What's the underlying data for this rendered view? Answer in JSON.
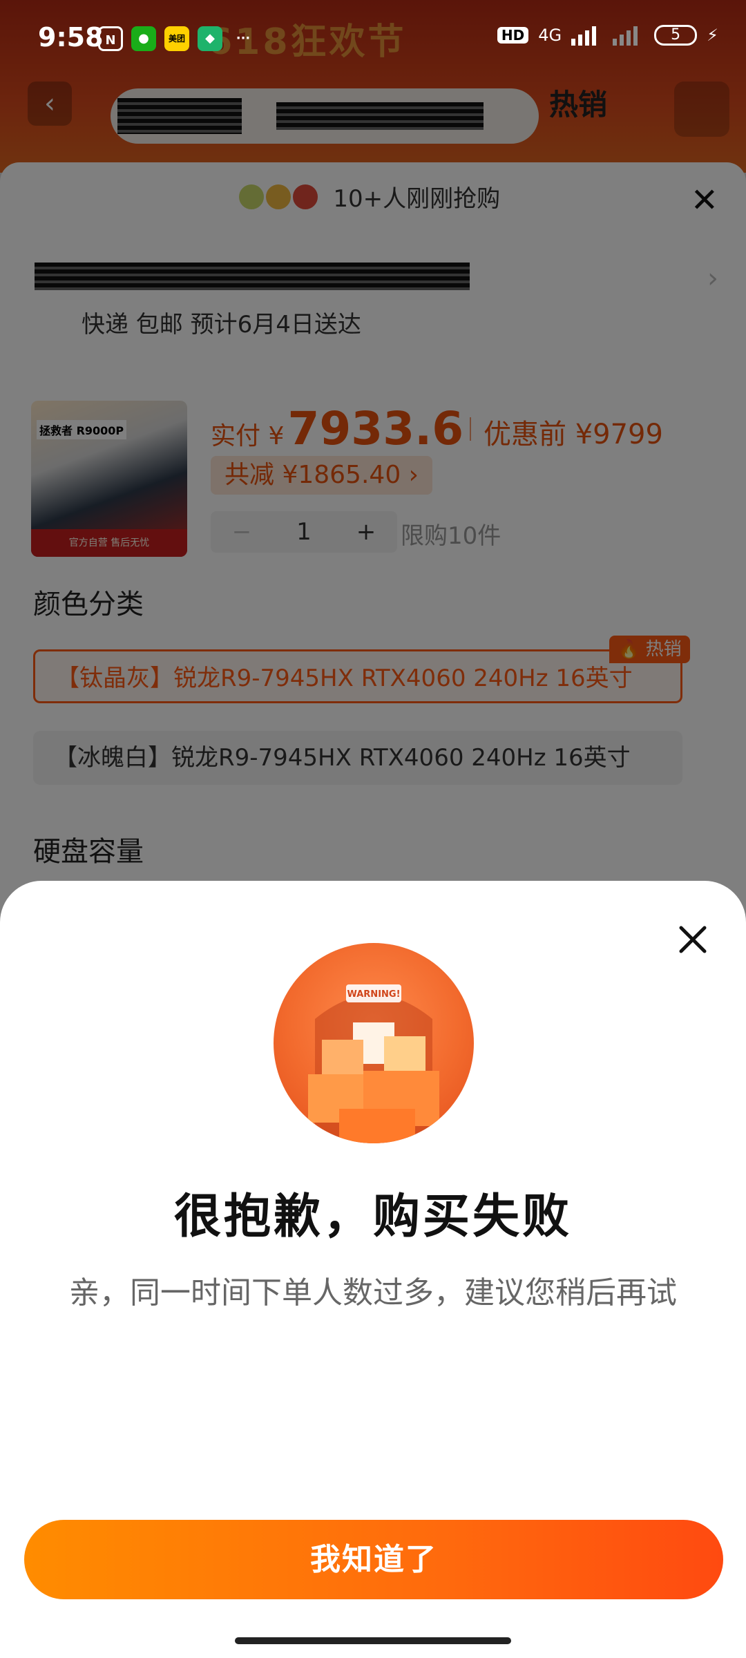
{
  "status_bar": {
    "time": "9:58",
    "app_icons": [
      "nfc-icon",
      "wechat-icon",
      "meituan-icon",
      "shield-icon",
      "more-icon"
    ],
    "meituan_label": "美团",
    "more_label": "···",
    "hd_label": "HD",
    "network_label": "4G",
    "battery_level": "5"
  },
  "background": {
    "banner_text": "618狂欢节",
    "hot_label": "热销",
    "buyers_note": "10+人刚刚抢购",
    "delivery": "快递 包邮 预计6月4日送达",
    "product_thumb_title": "拯救者 R9000P",
    "product_thumb_footer": "官方自营 售后无忧",
    "price_prefix": "实付 ¥",
    "price_value": "7933.6",
    "price_before": "优惠前 ¥9799",
    "discount": "共减 ¥1865.40 ›",
    "quantity": "1",
    "qty_minus": "−",
    "qty_plus": "+",
    "purchase_limit": "限购10件",
    "color_section_title": "颜色分类",
    "color_options": [
      "【钛晶灰】锐龙R9-7945HX RTX4060 240Hz 16英寸",
      "【冰魄白】锐龙R9-7945HX RTX4060 240Hz 16英寸"
    ],
    "hot_tag": "🔥 热销",
    "storage_section_title": "硬盘容量"
  },
  "modal": {
    "title": "很抱歉，购买失败",
    "message": "亲，同一时间下单人数过多，建议您稍后再试",
    "confirm_label": "我知道了",
    "image_text": "WARNING!"
  },
  "colors": {
    "accent": "#ff5b14",
    "button_start": "#ff8c00",
    "button_end": "#ff4a10"
  }
}
